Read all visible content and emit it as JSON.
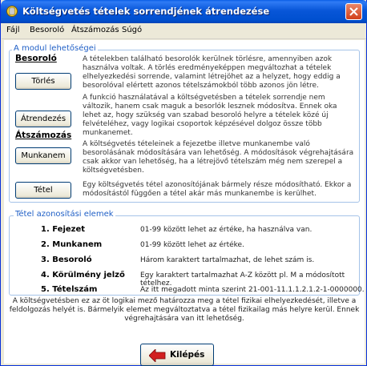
{
  "window": {
    "title": "Költségvetés tételek sorrendjének átrendezése"
  },
  "menu": [
    "Fájl",
    "Besoroló",
    "Átszámozás",
    "Súgó"
  ],
  "modules": {
    "legend": "A modul lehetőségei",
    "besorolo": {
      "heading": "Besoroló",
      "torles_label": "Törlés",
      "torles_desc": "A tételekben található besorolók kerülnek törlésre, amennyiben azok használva voltak. A törlés eredményeképpen megváltozhat a tételek elhelyezkedési sorrende, valamint létrejöhet az a helyzet, hogy eddig a besorolóval elértett azonos tételszámokból több azonos jön létre.",
      "atrendezes_label": "Átrendezés",
      "atrendezes_desc": "A funkció használatával a költségvetésben a tételek sorrendje nem változik, hanem csak maguk a besorlók lesznek módosítva. Ennek oka lehet az, hogy szükség van szabad besoroló helyre a tételek közé új felvételéhez, vagy logikai csoportok képzésével dolgoz össze több munkanemet."
    },
    "atszamozas": {
      "heading": "Átszámozás",
      "munkanem_label": "Munkanem",
      "munkanem_desc": "A költségvetés tételeinek a fejezetbe illetve munkanembe való besorolásának módosítására van lehetőség. A módosítások végrehajtására csak akkor van lehetőség, ha a létrejövő tételszám még nem szerepel a költségvetésben.",
      "tetel_label": "Tétel",
      "tetel_desc": "Egy költségvetés tétel azonosítójának bármely része módosítható. Ekkor a módosítástól függően a tétel akár más munkanembe is kerülhet."
    }
  },
  "identifiers": {
    "legend": "Tétel azonosítási elemek",
    "items": [
      {
        "label": "1. Fejezet",
        "text": "01-99 között lehet az értéke, ha használva van."
      },
      {
        "label": "2. Munkanem",
        "text": "01-99 között lehet az értéke."
      },
      {
        "label": "3. Besoroló",
        "text": "Három karaktert tartalmazhat, de lehet szám is."
      },
      {
        "label": "4. Körülmény jelző",
        "text": "Egy karaktert tartalmazhat A-Z között pl. M a módosított tételhez."
      },
      {
        "label": "5. Tételszám",
        "text": "Az itt megadott minta szerint 21-001-11.1.1.2.1.2-1-0000000."
      }
    ]
  },
  "footer_note": "A költségvetésben ez az öt logikai mező határozza meg a tétel fizikai elhelyezkedését, illetve a feldolgozás helyét is. Bármelyik elemet megváltoztatva a tétel fizikailag más helyre kerül. Ennek végrehajtására van itt lehetőség.",
  "exit_label": "Kilépés",
  "colors": {
    "title_blue": "#0054e3",
    "legend_blue": "#1f5fc6",
    "close_red": "#d2401a",
    "exit_arrow_red": "#d22020"
  }
}
